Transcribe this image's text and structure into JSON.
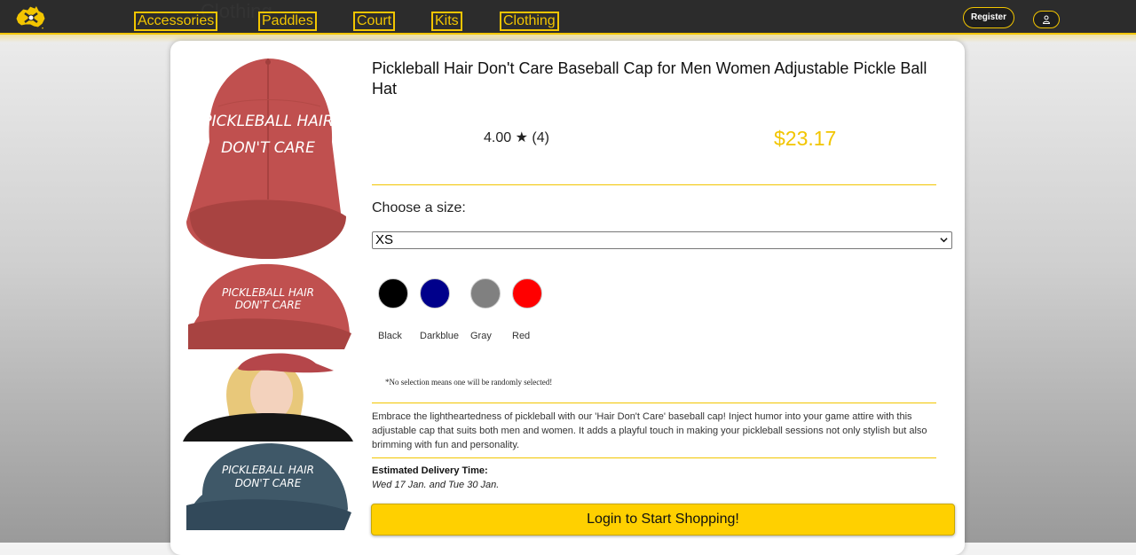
{
  "nav": {
    "links": [
      "Accessories",
      "Paddles",
      "Court",
      "Kits",
      "Clothing"
    ],
    "ghost_text": "Clothing",
    "register_label": "Register"
  },
  "product": {
    "title": "Pickleball Hair Don't Care Baseball Cap for Men Women Adjustable Pickle Ball Hat",
    "rating": "4.00 ★ (4)",
    "price": "$23.17",
    "cap_text_line1": "PICKLEBALL HAIR",
    "cap_text_line2": "DON'T CARE",
    "size_label": "Choose a size:",
    "size_selected": "XS",
    "colors": [
      {
        "label": "Black",
        "hex": "#000000"
      },
      {
        "label": "Darkblue",
        "hex": "#00008b"
      },
      {
        "label": "Gray",
        "hex": "#808080"
      },
      {
        "label": "Red",
        "hex": "#ff0000"
      }
    ],
    "color_note": "*No selection means one will be randomly selected!",
    "description": "Embrace the lightheartedness of pickleball with our 'Hair Don't Care' baseball cap! Inject humor into your game attire with this adjustable cap that suits both men and women. It adds a playful touch in making your pickleball sessions not only stylish but also brimming with fun and personality.",
    "delivery_label": "Estimated Delivery Time:",
    "delivery_dates": "Wed 17 Jan. and Tue 30 Jan.",
    "cta_label": "Login to Start Shopping!"
  },
  "colors": {
    "accent": "#f2c500",
    "cta": "#ffd000",
    "nav_bg": "#2c2c2c"
  }
}
